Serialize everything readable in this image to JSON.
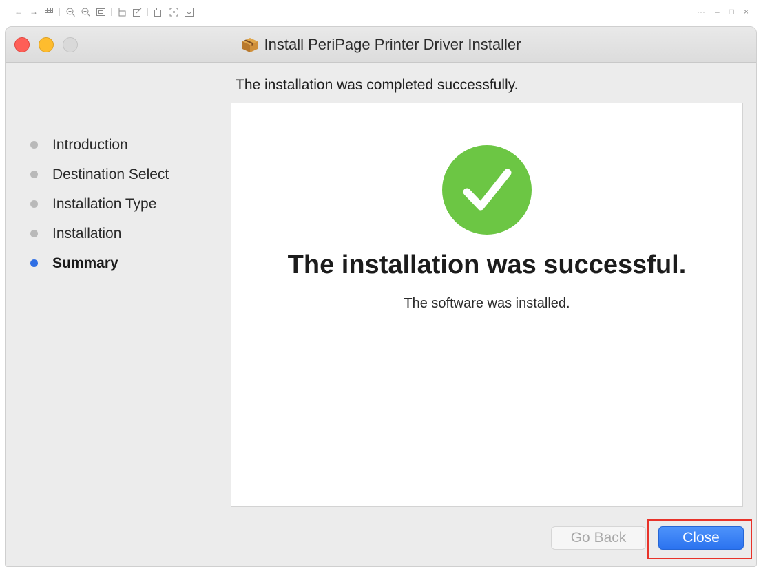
{
  "viewer": {
    "toolbar_icons": [
      "back-arrow-icon",
      "forward-arrow-icon",
      "grid-icon",
      "zoom-in-icon",
      "zoom-out-icon",
      "fit-icon",
      "rotate-icon",
      "edit-icon",
      "copy-icon",
      "crop-icon",
      "download-icon"
    ],
    "right_controls": [
      "more-icon",
      "minimize-icon",
      "maximize-icon",
      "close-icon"
    ]
  },
  "window": {
    "title": "Install PeriPage Printer Driver Installer"
  },
  "main": {
    "heading": "The installation was completed successfully.",
    "success_title": "The installation was successful.",
    "success_subtitle": "The software was installed."
  },
  "sidebar": {
    "steps": [
      {
        "label": "Introduction",
        "active": false
      },
      {
        "label": "Destination Select",
        "active": false
      },
      {
        "label": "Installation Type",
        "active": false
      },
      {
        "label": "Installation",
        "active": false
      },
      {
        "label": "Summary",
        "active": true
      }
    ]
  },
  "buttons": {
    "go_back": "Go Back",
    "close": "Close"
  },
  "colors": {
    "success_green": "#6cc644",
    "accent_blue": "#2f6fe4",
    "highlight_red": "#e8332a"
  }
}
